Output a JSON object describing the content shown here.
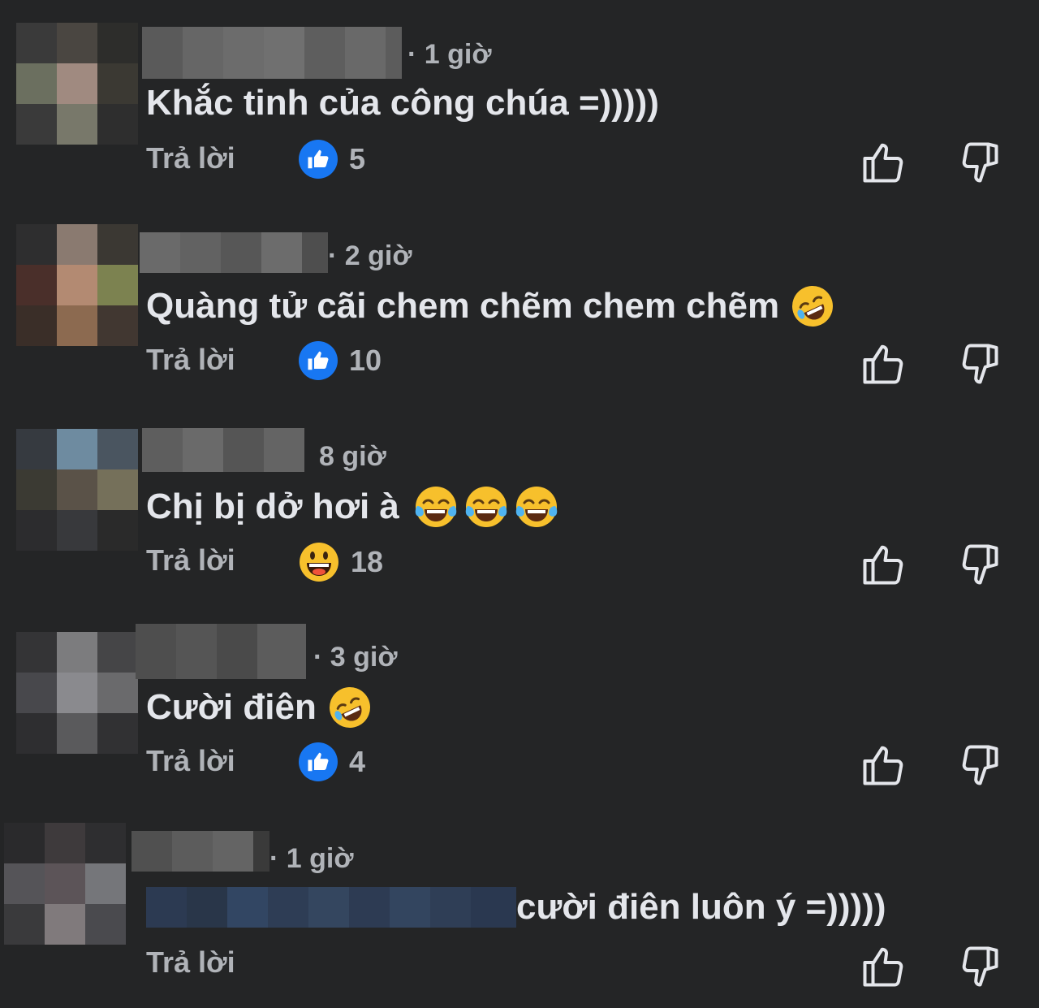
{
  "comments": [
    {
      "time": "· 1 giờ",
      "text": "Khắc tinh của công chúa =)))))",
      "reply_label": "Trả lời",
      "reaction": "like",
      "reaction_count": "5"
    },
    {
      "time": "· 2 giờ",
      "text": "Quàng tử cãi chem chẽm chem chẽm",
      "text_emojis": [
        "rofl"
      ],
      "reply_label": "Trả lời",
      "reaction": "like",
      "reaction_count": "10"
    },
    {
      "time": "8 giờ",
      "text": "Chị bị dở hơi à",
      "text_emojis": [
        "tears-of-joy",
        "tears-of-joy",
        "tears-of-joy"
      ],
      "reply_label": "Trả lời",
      "reaction": "haha",
      "reaction_count": "18"
    },
    {
      "time": "· 3 giờ",
      "text": "Cười điên",
      "text_emojis": [
        "rofl"
      ],
      "reply_label": "Trả lời",
      "reaction": "like",
      "reaction_count": "4"
    },
    {
      "time": "· 1 giờ",
      "text": "cười điên luôn ý =)))))",
      "reply_label": "Trả lời"
    }
  ],
  "icons": {
    "like_badge": "like-badge-icon",
    "haha_badge": "haha-emoji-icon",
    "upvote": "thumbs-up-outline-icon",
    "downvote": "thumbs-down-outline-icon"
  },
  "colors": {
    "background": "#242526",
    "text_primary": "#e4e6eb",
    "text_secondary": "#b0b3b8",
    "like_blue": "#1877f2"
  }
}
